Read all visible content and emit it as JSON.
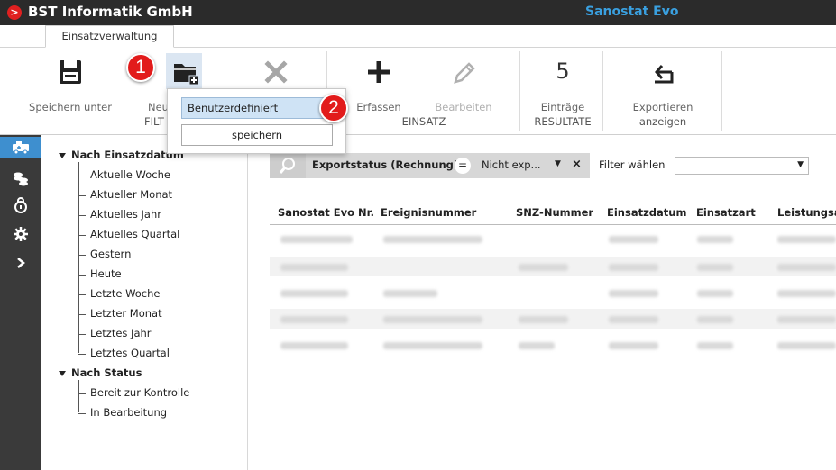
{
  "titlebar": {
    "company": "BST Informatik GmbH",
    "product": "Sanostat Evo",
    "logo_glyph": ">"
  },
  "tabs": [
    {
      "label": "Einsatzverwaltung"
    }
  ],
  "ribbon": {
    "speichern_unter": "Speichern unter",
    "neu": "Neu",
    "filter_group": "FILT",
    "erfassen": "Erfassen",
    "bearbeiten": "Bearbeiten",
    "einsatz_group": "EINSATZ",
    "entries_count": "5",
    "eintraege": "Einträge",
    "resultate_group": "RESULTATE",
    "exportieren": "Exportieren",
    "anzeigen_group": "anzeigen"
  },
  "menu": {
    "option1": "Benutzerdefiniert",
    "option2": "speichern"
  },
  "callouts": {
    "step1": "1",
    "step2": "2"
  },
  "tree": {
    "section1": "Nach Einsatzdatum",
    "items1": [
      "Aktuelle Woche",
      "Aktueller Monat",
      "Aktuelles Jahr",
      "Aktuelles Quartal",
      "Gestern",
      "Heute",
      "Letzte Woche",
      "Letzter Monat",
      "Letztes Jahr",
      "Letztes Quartal"
    ],
    "section2": "Nach Status",
    "items2": [
      "Bereit zur Kontrolle",
      "In Bearbeitung"
    ]
  },
  "filter": {
    "field": "Exportstatus (Rechnung)",
    "operator": "=",
    "value": "Nicht exp...",
    "remove": "×",
    "add_label": "Filter wählen",
    "add_value": ""
  },
  "table": {
    "headers": [
      "Sanostat Evo Nr.",
      "Ereignisnummer",
      "SNZ-Nummer",
      "Einsatzdatum",
      "Einsatzart",
      "Leistungsa"
    ]
  },
  "colors": {
    "accent": "#3e8fcf",
    "titlebar": "#2b2b2b",
    "callout": "#e21b1b",
    "product": "#3aa0e0"
  },
  "icons": {
    "leftbar": [
      "ambulance-icon",
      "coins-icon",
      "lock-icon",
      "gear-icon",
      "chevron-right-icon"
    ],
    "ribbon": [
      "save-icon",
      "folder-add-icon",
      "close-icon",
      "plus-icon",
      "pencil-icon",
      "export-icon"
    ]
  }
}
